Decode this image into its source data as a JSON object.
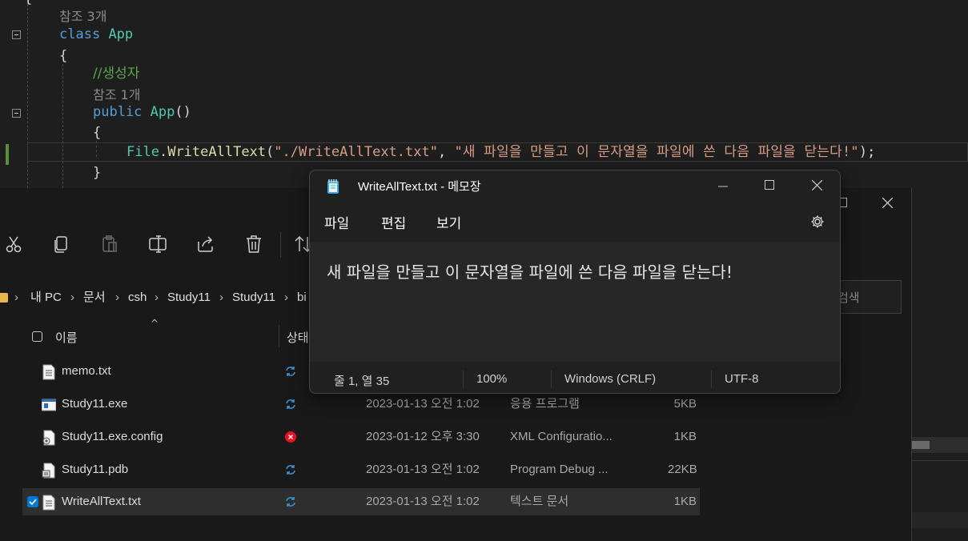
{
  "editor": {
    "codelens1": "참조 3개",
    "line_class_kw": "class",
    "line_class_name": "App",
    "brace_open1": "{",
    "comment": "//생성자",
    "codelens2": "참조 1개",
    "ctor_kw": "public",
    "ctor_name": "App",
    "ctor_parens": "()",
    "brace_open2": "{",
    "stmt_type": "File",
    "stmt_dot": ".",
    "stmt_method": "WriteAllText",
    "stmt_paren_open": "(",
    "stmt_arg1": "\"./WriteAllText.txt\"",
    "stmt_comma": ", ",
    "stmt_arg2": "\"새 파일을 만들고 이 문자열을 파일에 쓴 다음 파일을 닫는다!\"",
    "stmt_end": ");",
    "brace_close": "}",
    "top_brace": "{"
  },
  "explorer": {
    "toolbar": [
      "cut-icon",
      "copy-icon",
      "paste-icon",
      "rename-icon",
      "share-icon",
      "delete-icon",
      "sort-icon"
    ],
    "breadcrumb": [
      "내 PC",
      "문서",
      "csh",
      "Study11",
      "Study11",
      "bi"
    ],
    "search_placeholder": "검색",
    "columns": {
      "name": "이름",
      "status": "상태"
    },
    "files": [
      {
        "name": "memo.txt",
        "date": "",
        "type": "",
        "size": "",
        "status": "sync"
      },
      {
        "name": "Study11.exe",
        "date": "2023-01-13 오전 1:02",
        "type": "응용 프로그램",
        "size": "5KB",
        "status": "sync"
      },
      {
        "name": "Study11.exe.config",
        "date": "2023-01-12 오후 3:30",
        "type": "XML Configuratio...",
        "size": "1KB",
        "status": "error"
      },
      {
        "name": "Study11.pdb",
        "date": "2023-01-13 오전 1:02",
        "type": "Program Debug ...",
        "size": "22KB",
        "status": "sync"
      },
      {
        "name": "WriteAllText.txt",
        "date": "2023-01-13 오전 1:02",
        "type": "텍스트 문서",
        "size": "1KB",
        "status": "sync",
        "selected": true
      }
    ]
  },
  "notepad": {
    "title": "WriteAllText.txt - 메모장",
    "menu": [
      "파일",
      "편집",
      "보기"
    ],
    "content": "새 파일을 만들고 이 문자열을 파일에 쓴 다음 파일을 닫는다!",
    "status": {
      "position": "줄 1, 열 35",
      "zoom": "100%",
      "line_ending": "Windows (CRLF)",
      "encoding": "UTF-8"
    }
  },
  "colors": {
    "accent": "#0078d4",
    "error": "#e81123",
    "sync": "#3a96dd"
  }
}
